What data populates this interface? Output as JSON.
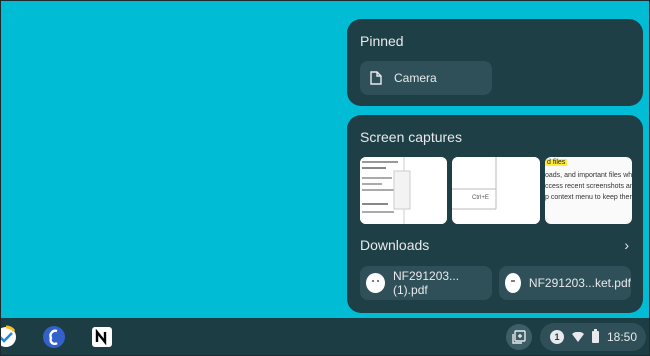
{
  "pinned": {
    "title": "Pinned",
    "items": [
      {
        "label": "Camera",
        "icon": "file-icon"
      }
    ]
  },
  "screen_captures": {
    "title": "Screen captures",
    "thumb2_text": "Ctrl+E",
    "thumb3_highlight": "d files",
    "thumb3_lines": [
      "oads, and important files which",
      "ccess recent screenshots and",
      "p context menu to keep them"
    ]
  },
  "downloads": {
    "title": "Downloads",
    "chevron": "›",
    "items": [
      {
        "label": "NF291203... (1).pdf"
      },
      {
        "label": "NF291203...ket.pdf"
      }
    ]
  },
  "shelf": {
    "apps": [
      "tasks-app-icon",
      "simplenote-app-icon",
      "notion-app-icon"
    ],
    "notification_count": "1",
    "time": "18:50"
  },
  "colors": {
    "desktop": "#00bcd4",
    "panel": "#1e3f46",
    "chip": "#2f5058",
    "shelf": "#1c3d44"
  }
}
